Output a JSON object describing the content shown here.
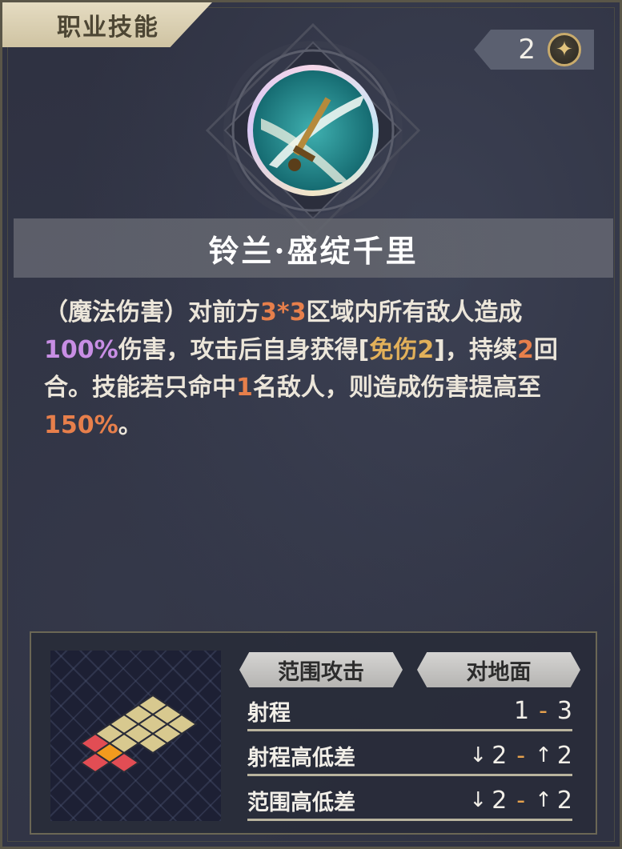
{
  "header": {
    "title": "职业技能"
  },
  "cost": {
    "value": "2",
    "icon": "star-coin-icon"
  },
  "skill": {
    "icon": "sword-slash-icon",
    "name": "铃兰·盛绽千里"
  },
  "description": {
    "p1": "（魔法伤害）对前方",
    "v1": "3*3",
    "p2": "区域内所有敌人造成",
    "v2": "100%",
    "p3": "伤害，攻击后自身获得[",
    "v3": "免伤2",
    "p4": "]，持续",
    "v4": "2",
    "p5": "回合。技能若只命中",
    "v5": "1",
    "p6": "名敌人，则造成伤害提高至",
    "v6": "150%",
    "p7": "。"
  },
  "tags": {
    "attack_type": "范围攻击",
    "target_type": "对地面"
  },
  "stats": {
    "range": {
      "label": "射程",
      "min": "1",
      "sep": "-",
      "max": "3"
    },
    "range_height": {
      "label": "射程高低差",
      "down": "2",
      "sep": "-",
      "up": "2"
    },
    "area_height": {
      "label": "范围高低差",
      "down": "2",
      "sep": "-",
      "up": "2"
    }
  },
  "colors": {
    "highlight_orange": "#e77f4b",
    "highlight_purple": "#c88ee4",
    "highlight_gold": "#e2b05a",
    "aoe_tile": "#d8c98f",
    "origin_tile": "#f29a1e",
    "enemy_tile": "#e24d54"
  }
}
